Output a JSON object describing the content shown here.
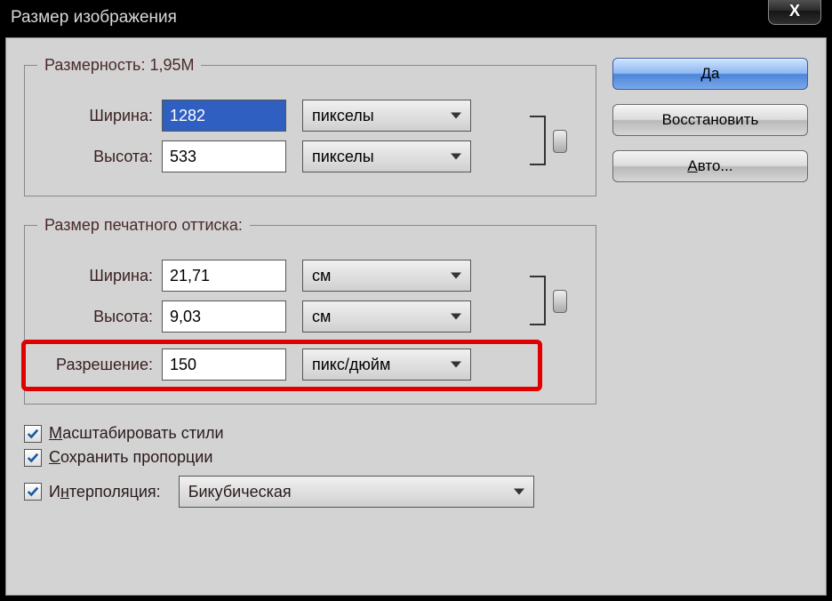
{
  "window": {
    "title": "Размер изображения",
    "close_label": "X"
  },
  "buttons": {
    "ok": "Да",
    "reset": "Восстановить",
    "auto": "Авто..."
  },
  "pixel_dims": {
    "legend": "Размерность:  1,95M",
    "width_label": "Ширина:",
    "width_value": "1282",
    "width_unit": "пикселы",
    "height_label": "Высота:",
    "height_value": "533",
    "height_unit": "пикселы"
  },
  "print_size": {
    "legend": "Размер печатного оттиска:",
    "width_label": "Ширина:",
    "width_value": "21,71",
    "width_unit": "см",
    "height_label": "Высота:",
    "height_value": "9,03",
    "height_unit": "см",
    "res_label": "Разрешение:",
    "res_value": "150",
    "res_unit": "пикс/дюйм"
  },
  "options": {
    "scale_styles": "Масштабировать стили",
    "constrain": "Сохранить пропорции",
    "resample_label": "Интерполяция:",
    "resample_value": "Бикубическая"
  }
}
